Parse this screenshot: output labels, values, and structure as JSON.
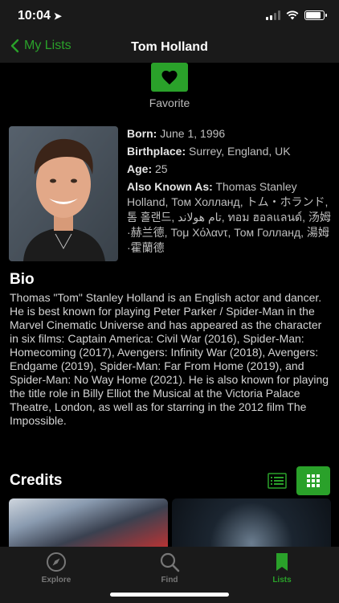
{
  "status": {
    "time": "10:04",
    "battery_level": 0.85,
    "signal_bars": 4,
    "signal_filled": 2
  },
  "nav": {
    "back_label": "My Lists",
    "title": "Tom Holland"
  },
  "favorite": {
    "label": "Favorite"
  },
  "person": {
    "born_label": "Born:",
    "born": "June 1, 1996",
    "birthplace_label": "Birthplace:",
    "birthplace": "Surrey, England, UK",
    "age_label": "Age:",
    "age": "25",
    "aka_label": "Also Known As:",
    "aka": "Thomas Stanley Holland, Том Холланд, トム・ホランド, 톰 홀랜드, تام هولاند, ทอม ฮอลแลนด์, 汤姆·赫兰德, Τομ Χόλαντ, Том Голланд, 湯姆·霍蘭德"
  },
  "bio": {
    "title": "Bio",
    "text": "Thomas \"Tom\" Stanley Holland is an English actor and dancer. He is best known for playing Peter Parker / Spider-Man in the Marvel Cinematic Universe and has appeared as the character in six films: Captain America: Civil War (2016), Spider-Man: Homecoming (2017), Avengers: Infinity War (2018), Avengers: Endgame (2019), Spider-Man: Far From Home (2019), and Spider-Man: No Way Home (2021). He is also known for playing the title role in Billy Elliot the Musical at the Victoria Palace Theatre, London, as well as for starring in the 2012 film The Impossible."
  },
  "credits": {
    "title": "Credits"
  },
  "tabs": [
    {
      "label": "Explore",
      "icon": "compass-icon",
      "active": false
    },
    {
      "label": "Find",
      "icon": "search-icon",
      "active": false
    },
    {
      "label": "Lists",
      "icon": "bookmark-icon",
      "active": true
    }
  ],
  "colors": {
    "accent": "#2aa12a",
    "bar_bg": "#1a1a1a",
    "background": "#000000"
  }
}
